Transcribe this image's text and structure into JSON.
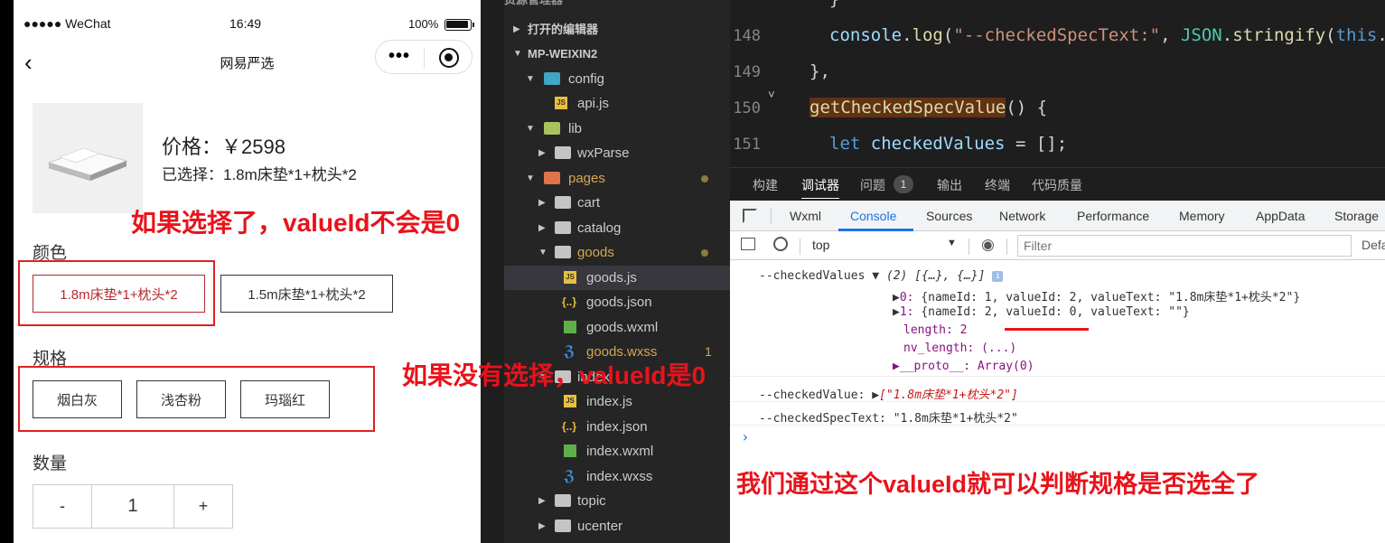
{
  "phone": {
    "status": {
      "carrier": "●●●●● WeChat",
      "time": "16:49",
      "battery": "100%"
    },
    "nav": {
      "back": "‹",
      "title": "网易严选",
      "menu": "•••"
    },
    "price": "价格：￥2598",
    "selected": "已选择：1.8m床垫*1+枕头*2",
    "color_label": "颜色",
    "color_options": [
      "1.8m床垫*1+枕头*2",
      "1.5m床垫*1+枕头*2"
    ],
    "spec_label": "规格",
    "spec_options": [
      "烟白灰",
      "浅杏粉",
      "玛瑙红"
    ],
    "qty_label": "数量",
    "qty": {
      "minus": "-",
      "value": "1",
      "plus": "+"
    }
  },
  "annotations": {
    "note1": "如果选择了，valueId不会是0",
    "note2": "如果没有选择，valueId是0",
    "note3": "我们通过这个valueId就可以判断规格是否选全了"
  },
  "explorer": {
    "top_cut": "资源管理器",
    "open_editors": "打开的编辑器",
    "project": "MP-WEIXIN2",
    "items": [
      {
        "name": "config"
      },
      {
        "name": "api.js"
      },
      {
        "name": "lib"
      },
      {
        "name": "wxParse"
      },
      {
        "name": "pages"
      },
      {
        "name": "cart"
      },
      {
        "name": "catalog"
      },
      {
        "name": "goods"
      },
      {
        "name": "goods.js"
      },
      {
        "name": "goods.json"
      },
      {
        "name": "goods.wxml"
      },
      {
        "name": "goods.wxss"
      },
      {
        "name": "index"
      },
      {
        "name": "index.js"
      },
      {
        "name": "index.json"
      },
      {
        "name": "index.wxml"
      },
      {
        "name": "index.wxss"
      },
      {
        "name": "topic"
      },
      {
        "name": "ucenter"
      }
    ],
    "wxss_badge": "1"
  },
  "editor": {
    "lines": [
      {
        "num": "148",
        "text": "console.log(\"--checkedSpecText:\", JSON.stringify(this.da"
      },
      {
        "num": "149",
        "text": "},"
      },
      {
        "num": "150",
        "text": "getCheckedSpecValue() {"
      },
      {
        "num": "151",
        "text": "let checkedValues = [];"
      }
    ]
  },
  "panel_tabs": [
    "构建",
    "调试器",
    "问题",
    "输出",
    "终端",
    "代码质量"
  ],
  "problems_count": "1",
  "devtools": {
    "tabs": [
      "Wxml",
      "Console",
      "Sources",
      "Network",
      "Performance",
      "Memory",
      "AppData",
      "Storage"
    ],
    "context": "top",
    "filter_placeholder": "Filter",
    "default_levels": "Defa",
    "console": {
      "l1_label": "--checkedValues",
      "l1_value": "(2) [{…}, {…}]",
      "l2_prefix": "0: ",
      "l2_text": "{nameId: 1, valueId: 2, valueText: \"1.8m床垫*1+枕头*2\"}",
      "l3_prefix": "1: ",
      "l3_text": "{nameId: 2, valueId: 0, valueText: \"\"}",
      "l4": "length: 2",
      "l5": "nv_length: (...)",
      "l6": "__proto__: Array(0)",
      "l7_label": "--checkedValue:",
      "l7_value": "[\"1.8m床垫*1+枕头*2\"]",
      "l8": "--checkedSpecText: \"1.8m床垫*1+枕头*2\"",
      "prompt": "›"
    }
  }
}
